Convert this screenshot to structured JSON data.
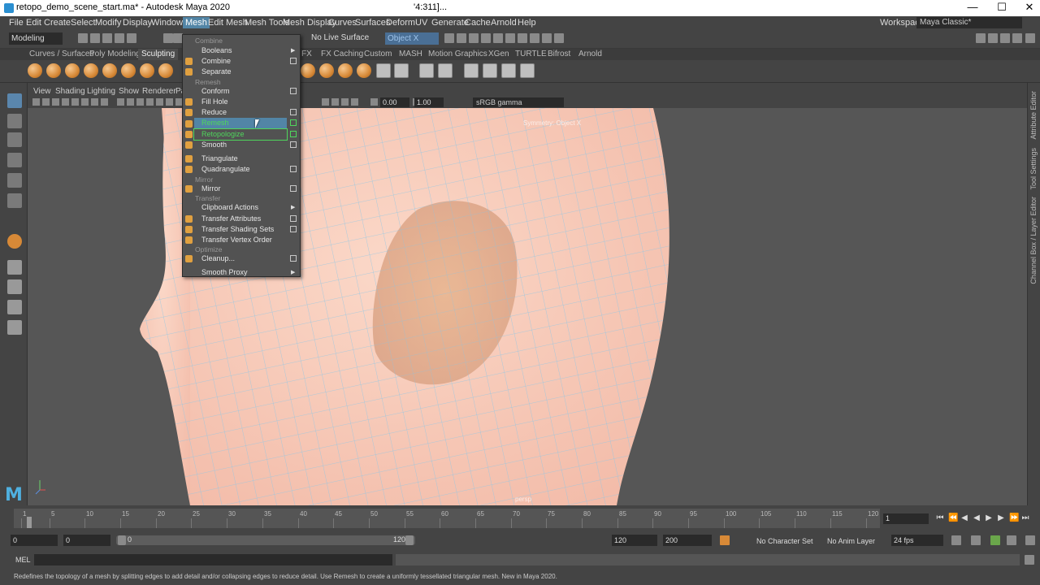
{
  "window": {
    "title": "retopo_demo_scene_start.ma* - Autodesk Maya 2020",
    "subtitle": "'4:311]...",
    "minimize": "—",
    "maximize": "☐",
    "close": "✕"
  },
  "menubar": {
    "items": [
      "File",
      "Edit",
      "Create",
      "Select",
      "Modify",
      "Display",
      "Windows",
      "Mesh",
      "Edit Mesh",
      "Mesh Tools",
      "Mesh Display",
      "Curves",
      "Surfaces",
      "Deform",
      "UV",
      "Generate",
      "Cache",
      "Arnold",
      "Help"
    ],
    "active": "Mesh",
    "workspace_label": "Workspace :",
    "workspace_value": "Maya Classic*"
  },
  "status_line": {
    "mode": "Modeling",
    "live_surface": "No Live Surface",
    "object_field": "Object X"
  },
  "shelf": {
    "tabs": [
      "Curves / Surfaces",
      "Poly Modeling",
      "Sculpting",
      "FX",
      "FX Caching",
      "Custom",
      "MASH",
      "Motion Graphics",
      "XGen",
      "TURTLE",
      "Bifrost",
      "Arnold"
    ],
    "active": "Sculpting"
  },
  "panel": {
    "menus": [
      "View",
      "Shading",
      "Lighting",
      "Show",
      "Renderer",
      "Pa"
    ],
    "exposure": "0.00",
    "gamma": "1.00",
    "color_space": "sRGB gamma"
  },
  "viewport": {
    "camera_label": "Symmetry: Object X",
    "camera_name": "persp"
  },
  "mesh_menu": {
    "sections": {
      "combine": "Combine",
      "remesh": "Remesh",
      "mirror": "Mirror",
      "transfer": "Transfer",
      "optimize": "Optimize"
    },
    "items": {
      "booleans": "Booleans",
      "combine": "Combine",
      "separate": "Separate",
      "conform": "Conform",
      "fill_hole": "Fill Hole",
      "reduce": "Reduce",
      "remesh": "Remesh",
      "retopologize": "Retopologize",
      "smooth": "Smooth",
      "triangulate": "Triangulate",
      "quadrangulate": "Quadrangulate",
      "mirror": "Mirror",
      "clipboard_actions": "Clipboard Actions",
      "transfer_attributes": "Transfer Attributes",
      "transfer_shading_sets": "Transfer Shading Sets",
      "transfer_vertex_order": "Transfer Vertex Order",
      "cleanup": "Cleanup...",
      "smooth_proxy": "Smooth Proxy"
    },
    "hovered": "Remesh"
  },
  "side_tabs": [
    "Attribute Editor",
    "Tool Settings",
    "Channel Box / Layer Editor"
  ],
  "timeline": {
    "ticks": [
      1,
      5,
      10,
      15,
      20,
      25,
      30,
      35,
      40,
      45,
      50,
      55,
      60,
      65,
      70,
      75,
      80,
      85,
      90,
      95,
      100,
      105,
      110,
      115,
      120
    ],
    "current_frame": "1"
  },
  "range": {
    "start": "0",
    "playback_start": "0",
    "slider_start": "0",
    "slider_end": "120",
    "playback_end": "120",
    "end": "200",
    "character_set": "No Character Set",
    "anim_layer": "No Anim Layer",
    "fps": "24 fps"
  },
  "command_line": {
    "label": "MEL"
  },
  "help_line": "Redefines the topology of a mesh by splitting edges to add detail and/or collapsing edges to reduce detail. Use Remesh to create a uniformly tessellated triangular mesh. New in Maya 2020.",
  "icons": {
    "logo": "maya-logo-icon",
    "select_tool": "select-arrow-icon",
    "lasso": "lasso-icon",
    "paint": "paint-select-icon",
    "move": "move-icon",
    "rotate": "rotate-icon",
    "scale": "scale-icon"
  },
  "colors": {
    "menu_highlight": "#5285a6",
    "retopo_green": "#4fd65c",
    "mesh_skin": "#f7c9b8",
    "wire": "#7fc3e6"
  }
}
